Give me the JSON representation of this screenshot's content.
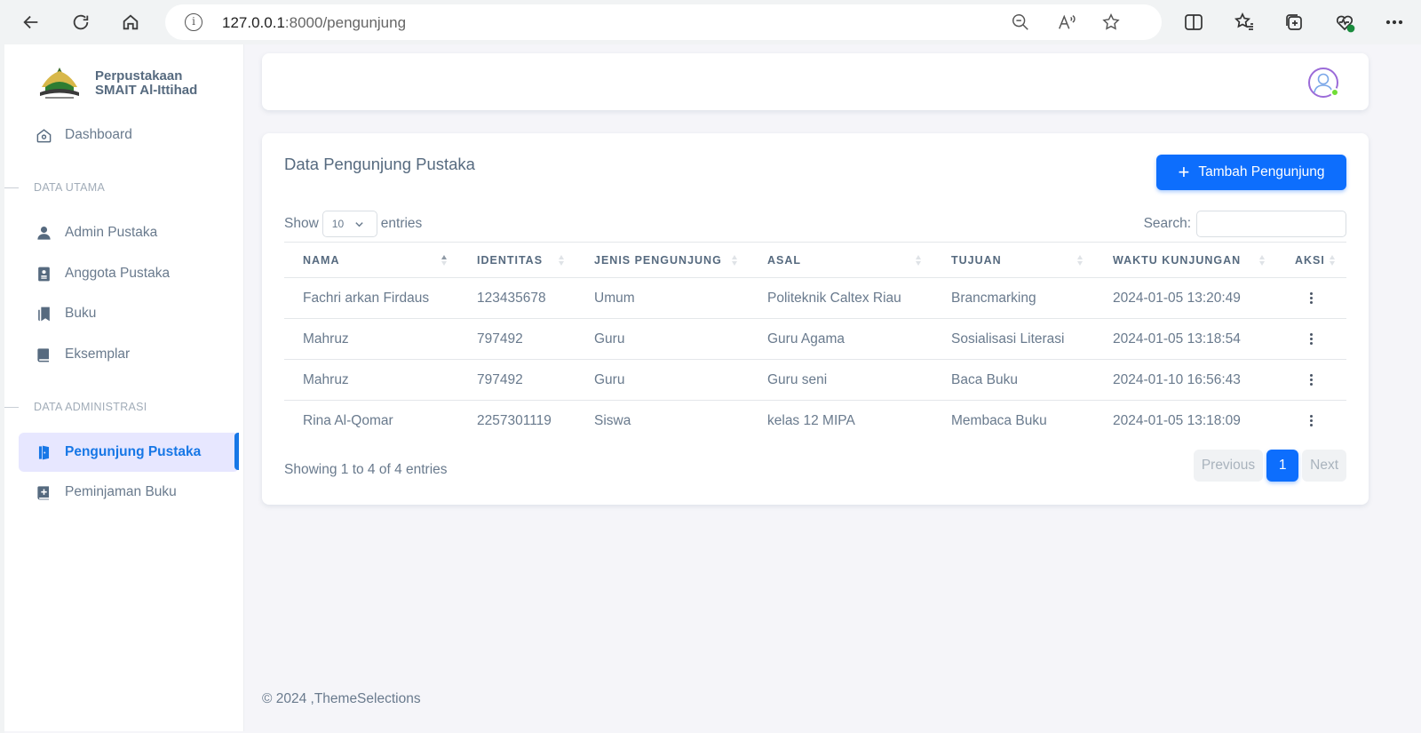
{
  "browser": {
    "url_host": "127.0.0.1",
    "url_path": ":8000/pengunjung",
    "info_glyph": "i"
  },
  "brand": {
    "line1": "Perpustakaan",
    "line2": "SMAIT Al-Ittihad"
  },
  "sidebar": {
    "dashboard": "Dashboard",
    "section_main": "DATA UTAMA",
    "admin": "Admin Pustaka",
    "anggota": "Anggota Pustaka",
    "buku": "Buku",
    "eksemplar": "Eksemplar",
    "section_admin": "DATA ADMINISTRASI",
    "pengunjung": "Pengunjung Pustaka",
    "peminjaman": "Peminjaman Buku",
    "active_item": "Pengunjung Pustaka"
  },
  "card": {
    "title": "Data Pengunjung Pustaka",
    "add_button": "Tambah Pengunjung",
    "add_icon": "+",
    "show_label": "Show",
    "entries_value": "10",
    "entries_label": "entries",
    "search_label": "Search:",
    "showing_text": "Showing 1 to 4 of 4 entries"
  },
  "table": {
    "headers": [
      "NAMA",
      "IDENTITAS",
      "JENIS PENGUNJUNG",
      "ASAL",
      "TUJUAN",
      "WAKTU KUNJUNGAN",
      "AKSI"
    ],
    "rows": [
      [
        "Fachri arkan Firdaus",
        "123435678",
        "Umum",
        "Politeknik Caltex Riau",
        "Brancmarking",
        "2024-01-05 13:20:49"
      ],
      [
        "Mahruz",
        "797492",
        "Guru",
        "Guru Agama",
        "Sosialisasi Literasi",
        "2024-01-05 13:18:54"
      ],
      [
        "Mahruz",
        "797492",
        "Guru",
        "Guru seni",
        "Baca Buku",
        "2024-01-10 16:56:43"
      ],
      [
        "Rina Al-Qomar",
        "2257301119",
        "Siswa",
        "kelas 12 MIPA",
        "Membaca Buku",
        "2024-01-05 13:18:09"
      ]
    ]
  },
  "pagination": {
    "previous": "Previous",
    "current": "1",
    "next": "Next"
  },
  "footer": {
    "text": "© 2024 ,ThemeSelections"
  },
  "colors": {
    "primary": "#0d6efd",
    "active_bg": "#e7e7ff",
    "online": "#71dd37"
  }
}
